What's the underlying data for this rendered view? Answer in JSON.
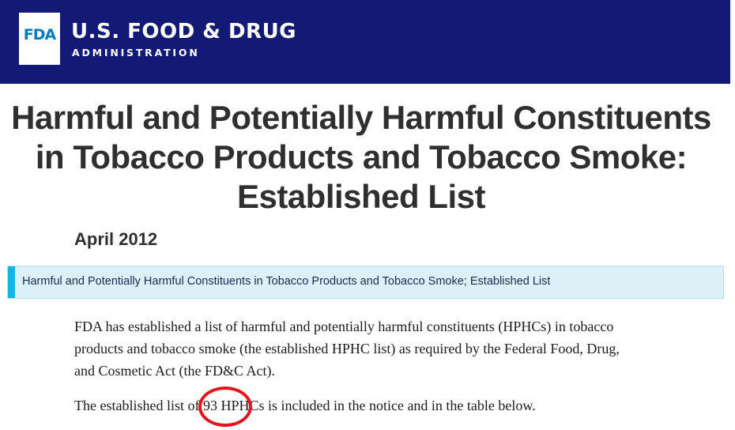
{
  "header": {
    "logo_text": "FDA",
    "agency_name": "U.S. FOOD & DRUG",
    "agency_sub": "ADMINISTRATION"
  },
  "title": "Harmful and Potentially Harmful Constituents in Tobacco Products and Tobacco Smoke: Established List",
  "date": "April 2012",
  "document_link": "Harmful and Potentially Harmful Constituents in Tobacco Products and Tobacco Smoke; Established List",
  "paragraphs": [
    "FDA has established a list of harmful and potentially harmful constituents (HPHCs) in tobacco products and tobacco smoke (the established HPHC list) as required by the Federal Food, Drug, and Cosmetic Act (the FD&C Act).",
    "The established list of 93 HPHCs is included in the notice and in the table below."
  ],
  "colors": {
    "header_bg": "#131a76",
    "logo_text": "#007cba",
    "link_box_bg": "#dcf0f7",
    "link_box_accent": "#14b6dd",
    "annotation": "#e0151d"
  },
  "annotation": {
    "type": "circle",
    "target_text": "93"
  }
}
